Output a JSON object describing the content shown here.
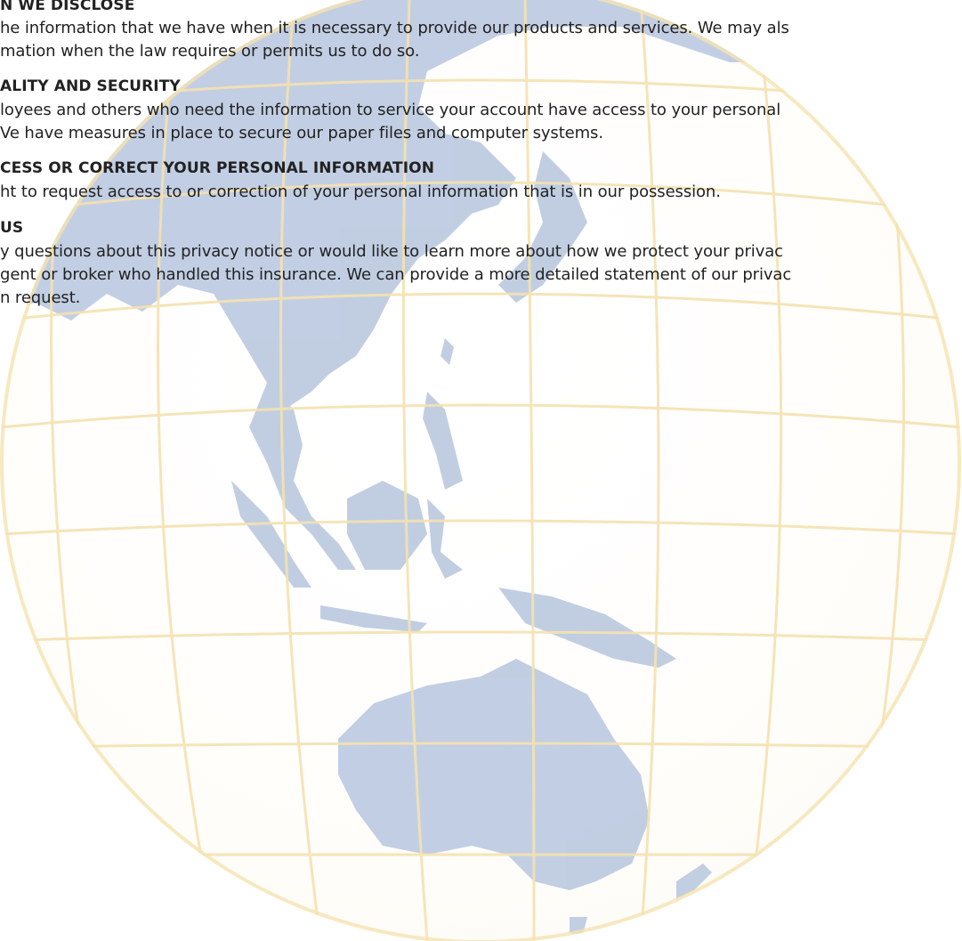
{
  "sections": [
    {
      "heading": "N WE DISCLOSE",
      "lines": [
        "he information that we have when it is necessary to provide our products and services. We may als",
        "mation when the law requires or permits us to do so."
      ]
    },
    {
      "heading": "ALITY AND SECURITY",
      "lines": [
        "loyees and others who need the information to service your account have access to your personal",
        "Ve have measures in place to secure our paper files and computer systems."
      ]
    },
    {
      "heading": "CESS OR CORRECT YOUR PERSONAL INFORMATION",
      "lines": [
        "ht to request access to or correction of your personal information that is in our possession."
      ]
    },
    {
      "heading": "US",
      "lines": [
        "y questions about this privacy notice or would like to learn more about how we protect your privac",
        "gent or broker who handled this insurance. We can provide a more detailed statement of our privac",
        "n request."
      ]
    }
  ],
  "colors": {
    "text": "#222222",
    "land": "#b7c6de",
    "grid": "#f5e2b0",
    "background": "#ffffff"
  }
}
